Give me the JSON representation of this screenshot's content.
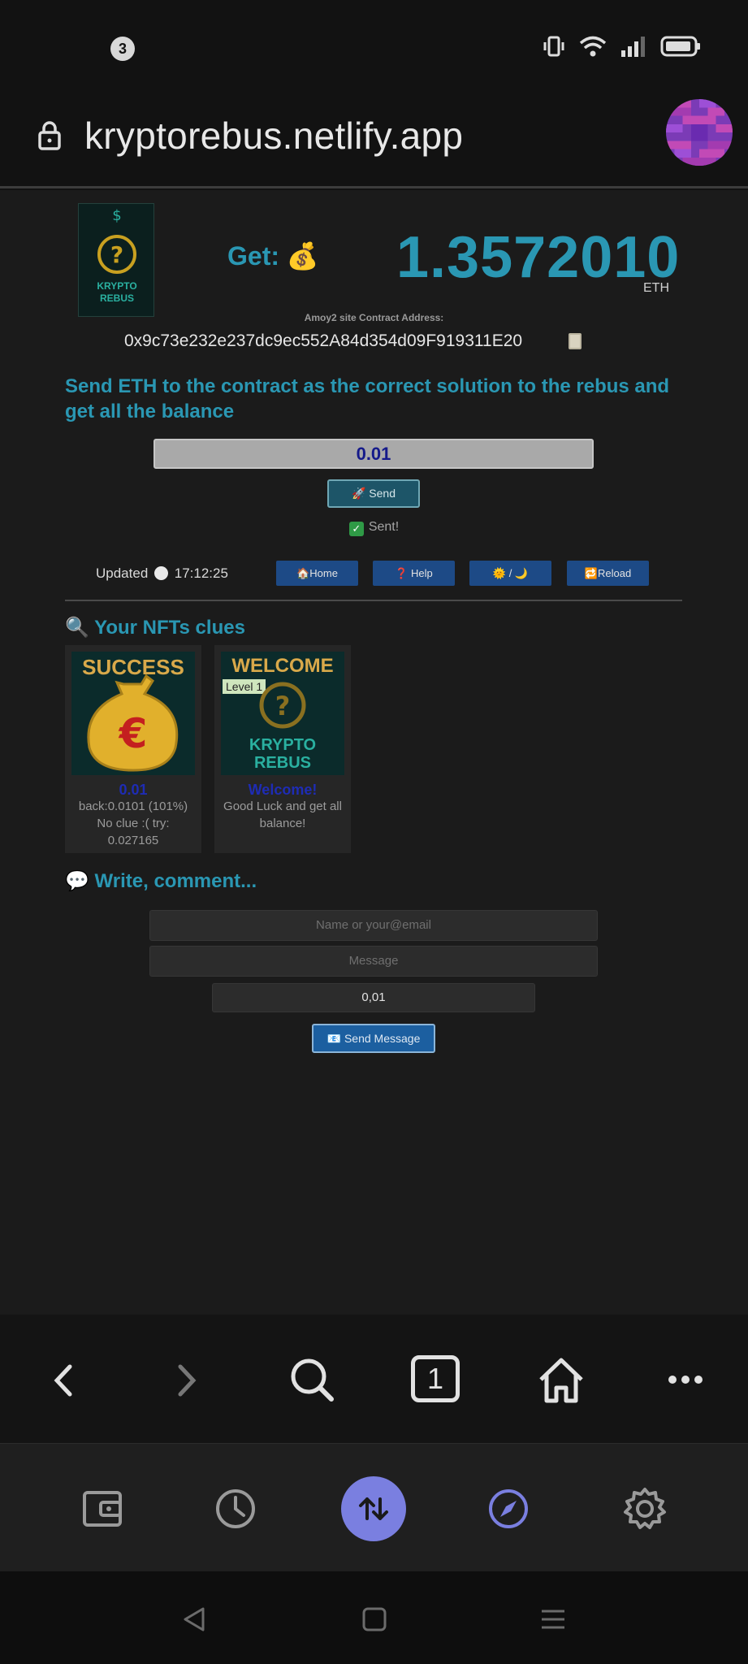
{
  "status_bar": {
    "notification_count": "3",
    "icons": [
      "vibrate-icon",
      "wifi-icon",
      "signal-icon",
      "battery-icon"
    ]
  },
  "browser": {
    "url": "kryptorebus.netlify.app"
  },
  "header": {
    "logo_text": "KRYPTO REBUS",
    "get_label": "Get: 💰",
    "balance": "1.3572010",
    "unit": "ETH",
    "address_label": "Amoy2 site Contract Address:",
    "address": "0x9c73e232e237dc9ec552A84d354d09F919311E20"
  },
  "send_section": {
    "headline": "Send ETH to the contract as the correct solution to the rebus and get all the balance",
    "amount_value": "0.01",
    "send_label": "🚀 Send",
    "status_text": "Sent!"
  },
  "info_bar": {
    "updated_label": "Updated",
    "time": "17:12:25",
    "buttons": [
      {
        "label": "🏠Home"
      },
      {
        "label": "❓ Help"
      },
      {
        "label": "🌞 / 🌙"
      },
      {
        "label": "🔁Reload"
      }
    ]
  },
  "nfts": {
    "title": "🔍 Your NFTs clues",
    "cards": [
      {
        "banner": "SUCCESS",
        "title": "0.01",
        "text": "back:0.0101 (101%) No clue :( try: 0.027165"
      },
      {
        "banner": "WELCOME",
        "level": "Level 1",
        "logo_text": "KRYPTO REBUS",
        "title": "Welcome!",
        "text": "Good Luck and get all balance!"
      }
    ]
  },
  "comment": {
    "title": "💬 Write, comment...",
    "name_placeholder": "Name or your@email",
    "message_placeholder": "Message",
    "amount_value": "0,01",
    "send_label": "📧 Send Message"
  },
  "toolbar": {
    "tab_count": "1"
  },
  "colors": {
    "accent": "#2a97b3",
    "page_bg": "#1b1b1b",
    "wallet_accent": "#7a7fe0"
  }
}
